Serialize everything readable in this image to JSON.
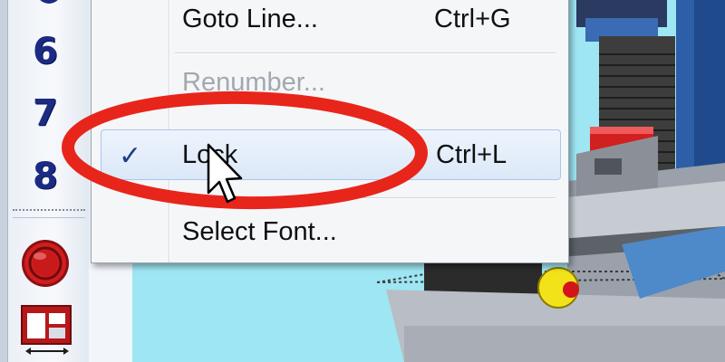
{
  "toolbar": {
    "tool_numbers": [
      "6",
      "7",
      "8"
    ],
    "icons": {
      "record": "record-icon",
      "layout": "layout-split-icon"
    }
  },
  "context_menu": {
    "items": [
      {
        "label": "Goto Line...",
        "shortcut": "Ctrl+G",
        "enabled": true,
        "checked": false
      },
      {
        "label": "Renumber...",
        "shortcut": "",
        "enabled": false,
        "checked": false
      },
      {
        "label": "Lock",
        "shortcut": "Ctrl+L",
        "enabled": true,
        "checked": true,
        "highlighted": true
      },
      {
        "label": "Select Font...",
        "shortcut": "",
        "enabled": true,
        "checked": false
      }
    ],
    "check_icon": "checkmark-icon"
  },
  "annotation": {
    "shape": "ellipse",
    "color": "#e8251b"
  },
  "colors": {
    "scene_background": "#9ee6f3",
    "tool_number": "#1b2b84",
    "record_button": "#c8191b",
    "highlight_border": "#a9c6ea"
  }
}
